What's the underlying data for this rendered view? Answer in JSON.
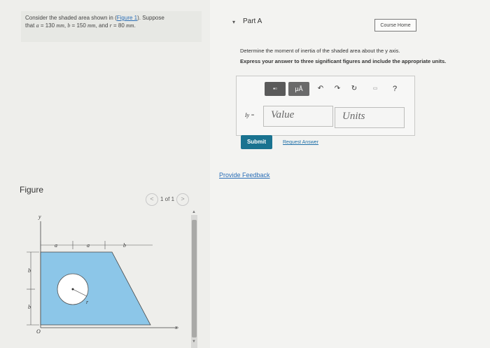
{
  "problem": {
    "line1_a": "Consider the shaded area shown in (",
    "figure_link": "Figure 1",
    "line1_b": "). Suppose",
    "line2_a": "that",
    "a_sym": "a",
    "a_val": "= 130",
    "a_unit": "mm",
    "b_sym": "b",
    "b_val": "= 150",
    "b_unit": "mm",
    "and": ", and",
    "r_sym": "r",
    "r_val": "= 80",
    "r_unit": "mm"
  },
  "figure": {
    "label": "Figure",
    "pager": "1 of 1",
    "prev": "<",
    "next": ">",
    "dim_a1": "a",
    "dim_a2": "a",
    "dim_b_top": "b",
    "dim_b_left1": "b",
    "dim_b_left2": "b",
    "axis_y": "y",
    "axis_x": "x",
    "origin": "O",
    "radius": "r",
    "colors": {
      "shaded": "#8cc6e8",
      "hole": "#ffffff"
    }
  },
  "part": {
    "toggle": "▾",
    "title": "Part A",
    "course_home": "Course Home",
    "instruction": "Determine the moment of inertia of the shaded area about the y axis.",
    "instruction2": "Express your answer to three significant figures and include the appropriate units.",
    "toolbar": {
      "templates_icon": "▪▫",
      "mu": "μÅ",
      "undo": "↶",
      "redo": "↷",
      "reset": "↻",
      "keyboard": "▭",
      "help": "?"
    },
    "iy_label": "Iy =",
    "value_placeholder": "Value",
    "units_placeholder": "Units",
    "submit": "Submit",
    "request_answer": "Request Answer",
    "feedback": "Provide Feedback"
  }
}
